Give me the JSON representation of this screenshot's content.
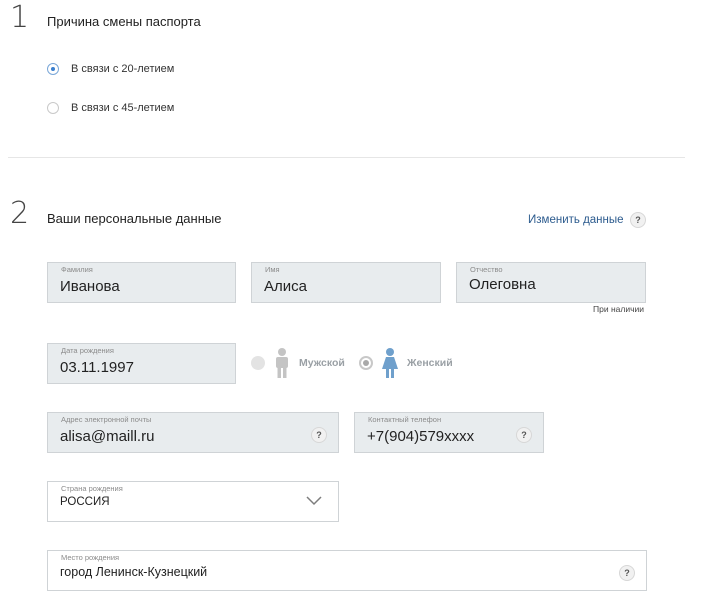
{
  "section1": {
    "number": "1",
    "title": "Причина смены паспорта",
    "options": [
      {
        "label": "В связи с 20-летием",
        "checked": true
      },
      {
        "label": "В связи с 45-летием",
        "checked": false
      }
    ]
  },
  "section2": {
    "number": "2",
    "title": "Ваши персональные данные",
    "edit_link": "Изменить данные",
    "help": "?",
    "surname": {
      "label": "Фамилия",
      "value": "Иванова"
    },
    "name": {
      "label": "Имя",
      "value": "Алиса"
    },
    "patronymic": {
      "label": "Отчество",
      "value": "Олеговна",
      "hint": "При наличии"
    },
    "birth_date": {
      "label": "Дата рождения",
      "value": "03.11.1997"
    },
    "gender": {
      "male": "Мужской",
      "female": "Женский",
      "selected": "female"
    },
    "email": {
      "label": "Адрес электронной почты",
      "value": "alisa@maill.ru"
    },
    "phone": {
      "label": "Контактный телефон",
      "value": "+7(904)579xxxx"
    },
    "birth_country": {
      "label": "Страна рождения",
      "value": "РОССИЯ"
    },
    "birth_place": {
      "label": "Место рождения",
      "value": "город Ленинск-Кузнецкий"
    }
  },
  "colors": {
    "accent": "#3a7fcf",
    "link": "#2c5b8e",
    "field_bg": "#e8ecee",
    "female_icon": "#6fa0cc",
    "male_icon": "#c4c4c4"
  },
  "icons": [
    "help-icon",
    "male-icon",
    "female-icon",
    "chevron-down-icon"
  ]
}
